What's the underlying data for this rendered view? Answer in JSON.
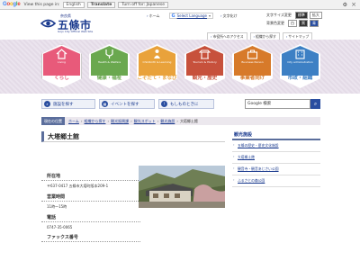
{
  "translate_bar": {
    "view_text": "View this page in:",
    "language": "English",
    "translate_button": "Translate",
    "turn_off_label": "Turn off for: Japanese",
    "settings_icon": "gear-icon",
    "close_icon": "close-icon"
  },
  "header": {
    "city_small": "奈良県",
    "city_name": "五條市",
    "city_en": "Gojo City Official Web Site",
    "links": [
      "ホーム",
      "文字化け"
    ],
    "google_label": "Select Language",
    "font_size_label": "文字サイズ変更",
    "font_sizes": [
      "標準",
      "拡大"
    ],
    "color_label": "背景色変更",
    "colors": [
      "白",
      "黒",
      "青"
    ],
    "sub_links": [
      "市役所へのアクセス",
      "組織から探す",
      "サイトマップ"
    ]
  },
  "nav": {
    "items": [
      {
        "en": "Living",
        "jp": "くらし",
        "color": "#e85a7a"
      },
      {
        "en": "Health & Welfare",
        "jp": "健康・福祉",
        "color": "#6aa84f"
      },
      {
        "en": "Childbirth & Learning",
        "jp": "こそだて・まなび",
        "color": "#e9a23b"
      },
      {
        "en": "Tourism & History",
        "jp": "観光・歴史",
        "color": "#c7513c"
      },
      {
        "en": "Business Person",
        "jp": "事業者向け",
        "color": "#d77a2a"
      },
      {
        "en": "City administration",
        "jp": "市政・組織",
        "color": "#3d80c4"
      }
    ]
  },
  "toolbar": {
    "buttons": [
      "施設を探す",
      "イベントを探す",
      "もしものときに"
    ],
    "search_placeholder": "Google 検索",
    "search_icon": "search-icon"
  },
  "breadcrumb": {
    "here_label": "現在の位置",
    "items": [
      "ホーム",
      "組織から探す",
      "観光振興課",
      "観光スポット",
      "観光施設"
    ],
    "current": "大塔郷土館"
  },
  "main": {
    "title": "大塔郷土館",
    "sections": [
      {
        "heading": "所在地",
        "value": "〒637-0417 五條市大塔町阪本209-1"
      },
      {
        "heading": "営業時間",
        "value": "11時～15時"
      },
      {
        "heading": "電話",
        "value": "0747-35-0065"
      },
      {
        "heading": "ファックス番号",
        "value": ""
      }
    ]
  },
  "sidebar": {
    "heading": "観光施設",
    "items": [
      "五條の歴史・歴史文化施設",
      "大塔郷土館",
      "観音寺・観音あじさい公園",
      "ふるさとの森公園"
    ]
  }
}
